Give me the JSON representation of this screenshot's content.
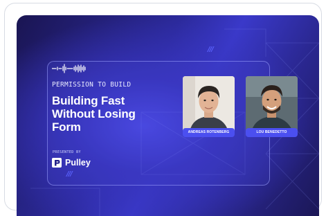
{
  "event": {
    "series": "PERMISSION TO BUILD",
    "title_lines": [
      "Building Fast",
      "Without Losing",
      "Form"
    ],
    "presented_by_label": "PRESENTED BY",
    "sponsor_name": "Pulley",
    "sponsor_icon": "pulley-logo-icon"
  },
  "speakers": [
    {
      "name": "ANDREAS ROTENBERG",
      "photo_icon": "speaker-photo"
    },
    {
      "name": "LOU BENEDETTO",
      "photo_icon": "speaker-photo"
    }
  ],
  "decor": {
    "slashes": "///"
  },
  "colors": {
    "banner_dark": "#1a1552",
    "banner_mid": "#3a39c9",
    "accent": "#4b4ff0",
    "text": "#ffffff"
  }
}
